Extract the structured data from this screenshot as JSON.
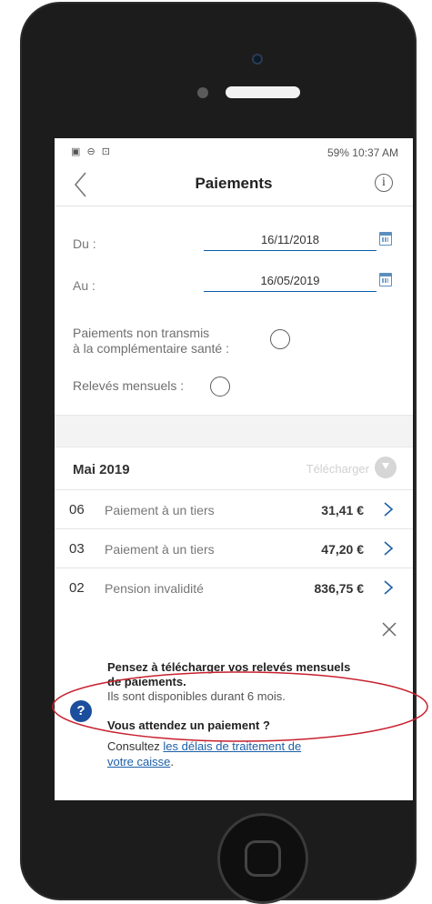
{
  "status_bar": {
    "right": "59% 10:37 AM"
  },
  "header": {
    "title": "Paiements",
    "info_glyph": "i"
  },
  "filters": {
    "from_label": "Du :",
    "from_value": "16/11/2018",
    "to_label": "Au :",
    "to_value": "16/05/2019",
    "non_transmitted_label_line1": "Paiements non transmis",
    "non_transmitted_label_line2": "à la complémentaire santé :",
    "monthly_statements_label": "Relevés mensuels :"
  },
  "month_section": {
    "title": "Mai 2019",
    "download_label": "Télécharger"
  },
  "payments": [
    {
      "day": "06",
      "description": "Paiement à un tiers",
      "amount": "31,41 €"
    },
    {
      "day": "03",
      "description": "Paiement à un tiers",
      "amount": "47,20 €"
    },
    {
      "day": "02",
      "description": "Pension invalidité",
      "amount": "836,75 €"
    }
  ],
  "banner": {
    "help_glyph": "?",
    "line1": "Pensez à télécharger vos relevés mensuels",
    "line2": "de paiements.",
    "line3": "Ils sont disponibles durant 6 mois.",
    "question": "Vous attendez un paiement ?",
    "consult_prefix": "Consultez ",
    "link_line1": "les délais de traitement de",
    "link_line2": "votre caisse",
    "suffix": "."
  },
  "colors": {
    "accent_blue": "#0a5ea8",
    "help_blue": "#1b4e9c",
    "highlight_red": "#c8202e"
  }
}
